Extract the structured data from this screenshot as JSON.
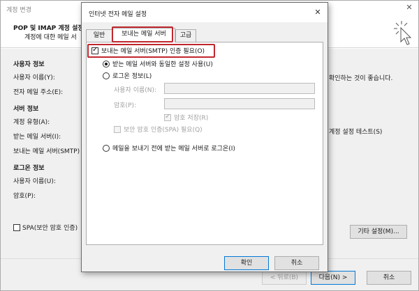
{
  "background_window": {
    "title": "계정 변경",
    "header_title": "POP 및 IMAP 계정 설정",
    "header_subtitle": "계정에 대한 메일 서",
    "sections": {
      "user_info": "사용자 정보",
      "server_info": "서버 정보",
      "logon_info": "로그온 정보"
    },
    "labels": {
      "user_name": "사용자 이름(Y):",
      "email_address": "전자 메일 주소(E):",
      "account_type": "계정 유형(A):",
      "incoming_server": "받는 메일 서버(I):",
      "outgoing_server": "보내는 메일 서버(SMTP)",
      "logon_user_name": "사용자 이름(U):",
      "password": "암호(P):"
    },
    "right_texts": {
      "recommend": "확인하는 것이 좋습니다.",
      "test": "계정 설정 테스트(S)"
    },
    "spa_checkbox": "SPA(보안 암호 인증)",
    "more_settings_button": "기타 설정(M)...",
    "footer": {
      "back": "< 뒤로(B)",
      "next": "다음(N) >",
      "cancel": "취소"
    }
  },
  "dialog": {
    "title": "인터넷 전자 메일 설정",
    "tabs": [
      "일반",
      "보내는 메일 서버",
      "고급"
    ],
    "active_tab": "보내는 메일 서버",
    "smtp_auth_checkbox": "보내는 메일 서버(SMTP) 인증 필요(O)",
    "radio_same_as_incoming": "받는 메일 서버와 동일한 설정 사용(U)",
    "radio_logon_info": "로그온 정보(L)",
    "field_user_name": "사용자 이름(N):",
    "field_password": "암호(P):",
    "remember_password": "암호 저장(R)",
    "spa_required": "보안 암호 인증(SPA) 필요(Q)",
    "radio_logon_before_send": "메일을 보내기 전에 받는 메일 서버로 로그온(I)",
    "ok_button": "확인",
    "cancel_button": "취소"
  },
  "colors": {
    "highlight_red": "#c0272d",
    "primary_blue": "#0078d7"
  }
}
